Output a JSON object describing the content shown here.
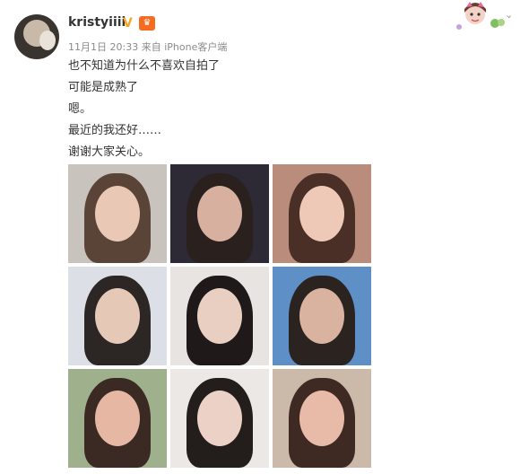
{
  "post": {
    "username": "kristyiiii",
    "verified_icon": "verified-v-icon",
    "member_icon": "member-crown-icon",
    "meta": {
      "date": "11月1日 20:33",
      "source_prefix": "来自",
      "source": "iPhone客户端"
    },
    "lines": [
      "也不知道为什么不喜欢自拍了",
      "可能是成熟了",
      "嗯。",
      "最近的我还好……",
      "谢谢大家关心。"
    ]
  },
  "photos": [
    {
      "name": "photo-1",
      "bg": "#c9c3be",
      "skin": "#e9c8b5",
      "hair": "#5a4337"
    },
    {
      "name": "photo-2",
      "bg": "#2d2a35",
      "skin": "#d7b0a0",
      "hair": "#2a211e"
    },
    {
      "name": "photo-3",
      "bg": "#b98c7b",
      "skin": "#efc9b7",
      "hair": "#4a2f27"
    },
    {
      "name": "photo-4",
      "bg": "#dcdfe6",
      "skin": "#e6c8b7",
      "hair": "#2c2624"
    },
    {
      "name": "photo-5",
      "bg": "#e7e4e1",
      "skin": "#e8cfc2",
      "hair": "#1f1a19"
    },
    {
      "name": "photo-6",
      "bg": "#5f8fc7",
      "skin": "#d9b39f",
      "hair": "#2b2320"
    },
    {
      "name": "photo-7",
      "bg": "#9fb08c",
      "skin": "#e6b8a4",
      "hair": "#3a2a23"
    },
    {
      "name": "photo-8",
      "bg": "#ece8e5",
      "skin": "#ecd2c6",
      "hair": "#231d1c"
    },
    {
      "name": "photo-9",
      "bg": "#cbb9a9",
      "skin": "#e7bba7",
      "hair": "#3e2a22"
    }
  ],
  "colors": {
    "text": "#333333",
    "meta": "#8a8a8a",
    "badge_v": "#f5a623",
    "badge_member": "#f56b1f"
  }
}
